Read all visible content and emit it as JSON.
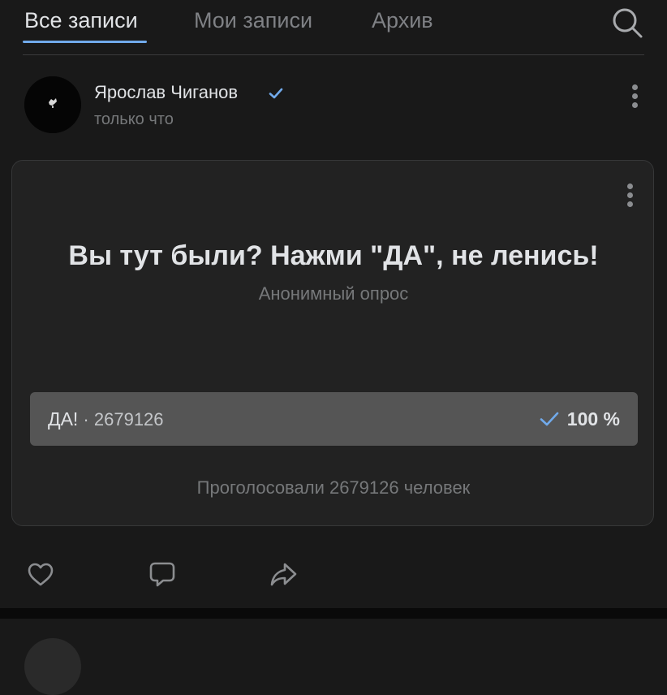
{
  "tabs": [
    {
      "label": "Все записи",
      "active": true
    },
    {
      "label": "Мои записи",
      "active": false
    },
    {
      "label": "Архив",
      "active": false
    }
  ],
  "icons": {
    "search": "search-icon",
    "verified": "check-icon",
    "menu": "more-vertical-icon",
    "like": "heart-icon",
    "comment": "comment-icon",
    "share": "share-icon"
  },
  "colors": {
    "background": "#191919",
    "card": "#222222",
    "accent": "#71aaeb",
    "option_fill": "#555555",
    "secondary_text": "#76787a"
  },
  "post": {
    "author": "Ярослав Чиганов",
    "time": "только что"
  },
  "poll": {
    "title": "Вы тут были? Нажми \"ДА\", не ленись!",
    "subtitle": "Анонимный опрос",
    "options": [
      {
        "label": "ДА!",
        "separator": " · ",
        "votes": "2679126",
        "percent": "100 %",
        "percent_value": 100,
        "selected": true
      }
    ],
    "total": "Проголосовали 2679126 человек"
  }
}
